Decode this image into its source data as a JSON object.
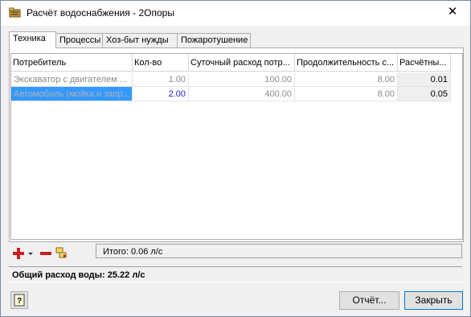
{
  "window": {
    "title": "Расчёт водоснабжения - 2Опоры",
    "close_glyph": "✕"
  },
  "tabs": [
    {
      "label": "Техника",
      "active": true
    },
    {
      "label": "Процессы",
      "active": false
    },
    {
      "label": "Хоз-быт нужды",
      "active": false
    },
    {
      "label": "Пожаротушение",
      "active": false
    }
  ],
  "table": {
    "columns": [
      "Потребитель",
      "Кол-во",
      "Суточный расход потр...",
      "Продолжительность с...",
      "Расчётны..."
    ],
    "rows": [
      {
        "name": "Экскаватор с двигателем ...",
        "qty": "1.00",
        "daily": "100.00",
        "duration": "8.00",
        "calc": "0.01",
        "selected": false
      },
      {
        "name": "Автомобиль (мойка и запр...",
        "qty": "2.00",
        "daily": "400.00",
        "duration": "8.00",
        "calc": "0.05",
        "selected": true
      }
    ]
  },
  "toolbar": {
    "add_icon": "plus-icon",
    "dropdown_icon": "dropdown-arrow-icon",
    "remove_icon": "minus-icon",
    "copy_icon": "copy-icon"
  },
  "summary": {
    "itogo": "Итого: 0.06 л/с",
    "total": "Общий расход воды: 25.22 л/с"
  },
  "buttons": {
    "report": "Отчёт...",
    "close": "Закрыть"
  },
  "colors": {
    "selection": "#3399ff",
    "accent_red": "#c81e1e",
    "default_button_border": "#0078d7"
  }
}
